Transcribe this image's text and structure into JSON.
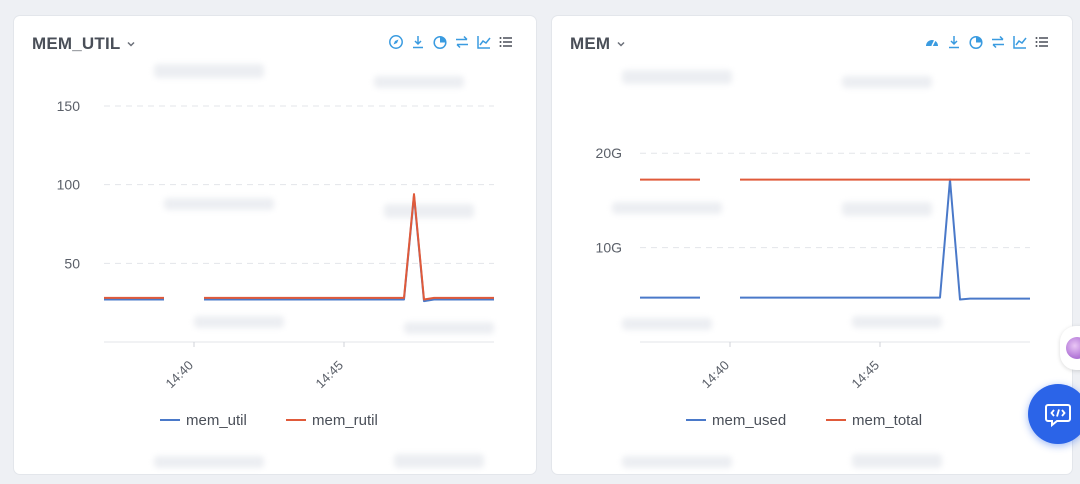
{
  "panels": [
    {
      "title": "MEM_UTIL"
    },
    {
      "title": "MEM"
    }
  ],
  "toolbar_icons": [
    "compass-icon",
    "download-icon",
    "pie-chart-icon",
    "swap-icon",
    "line-chart-icon",
    "list-icon"
  ],
  "colors": {
    "blue": "#4a79c9",
    "red": "#e05a3a",
    "accent": "#3a9be0"
  },
  "chart_data": [
    {
      "type": "line",
      "title": "MEM_UTIL",
      "xlabel": "",
      "ylabel": "",
      "x_ticks": [
        "14:40",
        "14:45"
      ],
      "y_ticks": [
        "50",
        "100",
        "150"
      ],
      "ylim": [
        0,
        150
      ],
      "grid": true,
      "legend_position": "bottom",
      "x": [
        "14:37:00",
        "14:38:00",
        "14:39:00",
        "14:39:40",
        "14:40:20",
        "14:41:00",
        "14:42:00",
        "14:43:00",
        "14:44:00",
        "14:45:00",
        "14:46:00",
        "14:47:00",
        "14:47:20",
        "14:47:40",
        "14:48:00",
        "14:49:00",
        "14:50:00"
      ],
      "series": [
        {
          "name": "mem_util",
          "values": [
            27,
            27,
            27,
            null,
            27,
            27,
            27,
            27,
            27,
            27,
            27,
            27,
            93,
            26,
            27,
            27,
            27
          ]
        },
        {
          "name": "mem_rutil",
          "values": [
            28,
            28,
            28,
            null,
            28,
            28,
            28,
            28,
            28,
            28,
            28,
            28,
            94,
            27,
            28,
            28,
            28
          ]
        }
      ]
    },
    {
      "type": "line",
      "title": "MEM",
      "xlabel": "",
      "ylabel": "",
      "x_ticks": [
        "14:40",
        "14:45"
      ],
      "y_ticks": [
        "10G",
        "20G"
      ],
      "ylim": [
        0,
        25
      ],
      "grid": true,
      "legend_position": "bottom",
      "x": [
        "14:37:00",
        "14:38:00",
        "14:39:00",
        "14:39:40",
        "14:40:20",
        "14:41:00",
        "14:42:00",
        "14:43:00",
        "14:44:00",
        "14:45:00",
        "14:46:00",
        "14:47:00",
        "14:47:20",
        "14:47:40",
        "14:48:00",
        "14:49:00",
        "14:50:00"
      ],
      "series": [
        {
          "name": "mem_used",
          "values": [
            4.7,
            4.7,
            4.7,
            null,
            4.7,
            4.7,
            4.7,
            4.7,
            4.7,
            4.7,
            4.7,
            4.7,
            17.2,
            4.5,
            4.6,
            4.6,
            4.6
          ]
        },
        {
          "name": "mem_total",
          "values": [
            17.2,
            17.2,
            17.2,
            null,
            17.2,
            17.2,
            17.2,
            17.2,
            17.2,
            17.2,
            17.2,
            17.2,
            17.2,
            17.2,
            17.2,
            17.2,
            17.2
          ]
        }
      ]
    }
  ]
}
